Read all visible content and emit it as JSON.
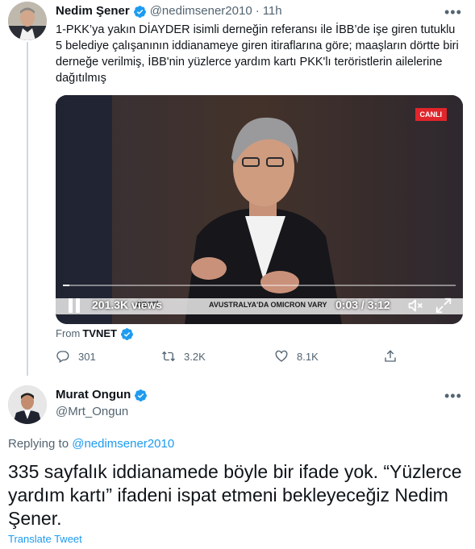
{
  "tweet1": {
    "author_name": "Nedim Şener",
    "handle": "@nedimsener2010",
    "separator": "·",
    "time": "11h",
    "text": "1-PKK’ya yakın DİAYDER isimli derneğin referansı ile İBB’de işe giren tutuklu 5 belediye çalışanının iddianameye giren itiraflarına göre; maaşların dörtte biri derneğe verilmiş, İBB'nin yüzlerce yardım kartı PKK'lı teröristlerin ailelerine dağıtılmış",
    "video": {
      "live_badge": "CANLI",
      "views": "201.3K views",
      "time": "0:03 / 3:12",
      "progress": 0.016,
      "ticker_left": "GEÇTİ",
      "ticker_text": "AVUSTRALYA'DA OMICRON VARY"
    },
    "source_prefix": "From",
    "source_name": "TVNET",
    "replies": "301",
    "retweets": "3.2K",
    "likes": "8.1K"
  },
  "tweet2": {
    "author_name": "Murat Ongun",
    "handle": "@Mrt_Ongun",
    "replying_prefix": "Replying to",
    "replying_handle": "@nedimsener2010",
    "text": "335 sayfalık iddianamede böyle bir ifade yok. “Yüzlerce yardım kartı” ifadeni ispat etmeni bekleyeceğiz Nedim Şener.",
    "translate": "Translate Tweet"
  },
  "colors": {
    "accent": "#1d9bf0",
    "secondary_text": "#536471",
    "live_red": "#e0252b"
  },
  "icons": [
    "verified-badge-icon",
    "more-icon",
    "reply-icon",
    "retweet-icon",
    "like-icon",
    "share-icon",
    "pause-icon",
    "volume-icon",
    "fullscreen-icon"
  ]
}
